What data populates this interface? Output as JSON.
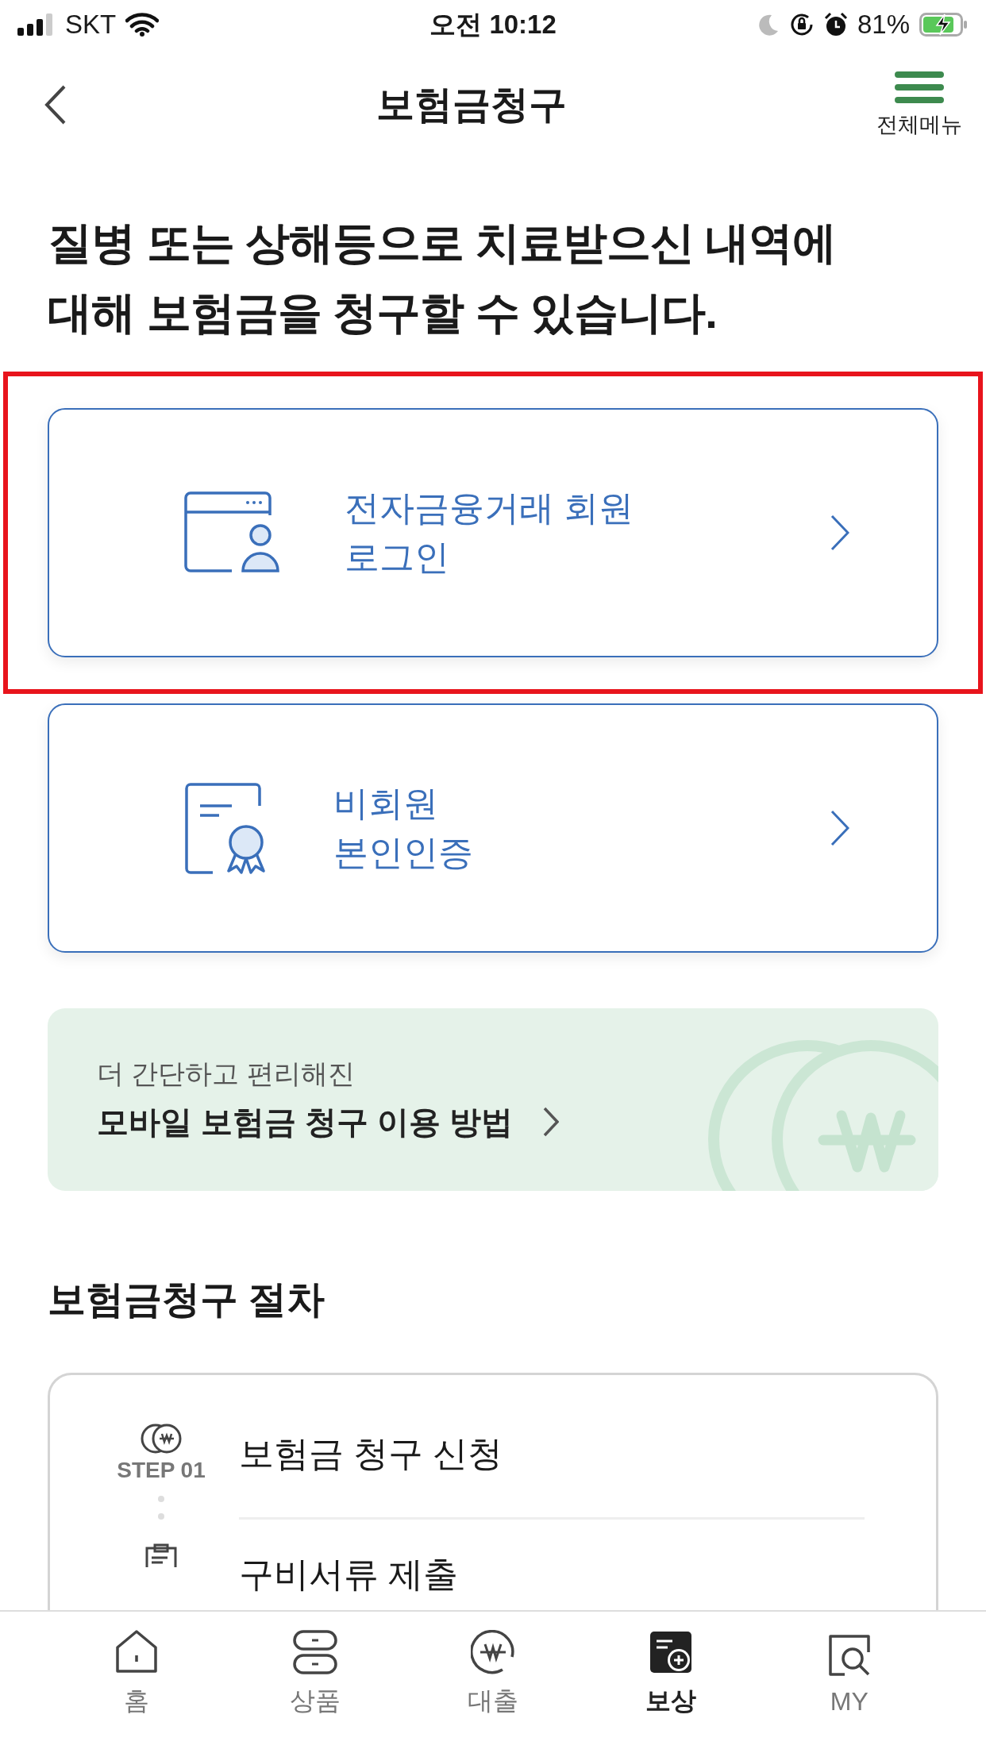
{
  "status_bar": {
    "carrier": "SKT",
    "time": "오전 10:12",
    "battery": "81%"
  },
  "header": {
    "title": "보험금청구",
    "menu_label": "전체메뉴"
  },
  "headline_lines": [
    "질병 또는 상해등으로 치료받으신 내역에",
    "대해 보험금을 청구할 수 있습니다."
  ],
  "login_options": [
    {
      "kind": "member",
      "lines": [
        "전자금융거래 회원",
        "로그인"
      ],
      "highlighted": true
    },
    {
      "kind": "guest",
      "lines": [
        "비회원",
        "본인인증"
      ],
      "highlighted": false
    }
  ],
  "guide_banner": {
    "subtitle": "더 간단하고 편리해진",
    "title": "모바일 보험금 청구 이용 방법"
  },
  "procedure": {
    "title": "보험금청구 절차",
    "steps": [
      {
        "kind": "apply",
        "step": "STEP 01",
        "title": "보험금 청구 신청"
      },
      {
        "kind": "documents",
        "title": "구비서류 제출"
      }
    ]
  },
  "tab_bar": [
    {
      "kind": "home",
      "label": "홈",
      "selected": false
    },
    {
      "kind": "products",
      "label": "상품",
      "selected": false
    },
    {
      "kind": "loan",
      "label": "대출",
      "selected": false
    },
    {
      "kind": "claim",
      "label": "보상",
      "selected": true
    },
    {
      "kind": "my",
      "label": "MY",
      "selected": false
    }
  ]
}
